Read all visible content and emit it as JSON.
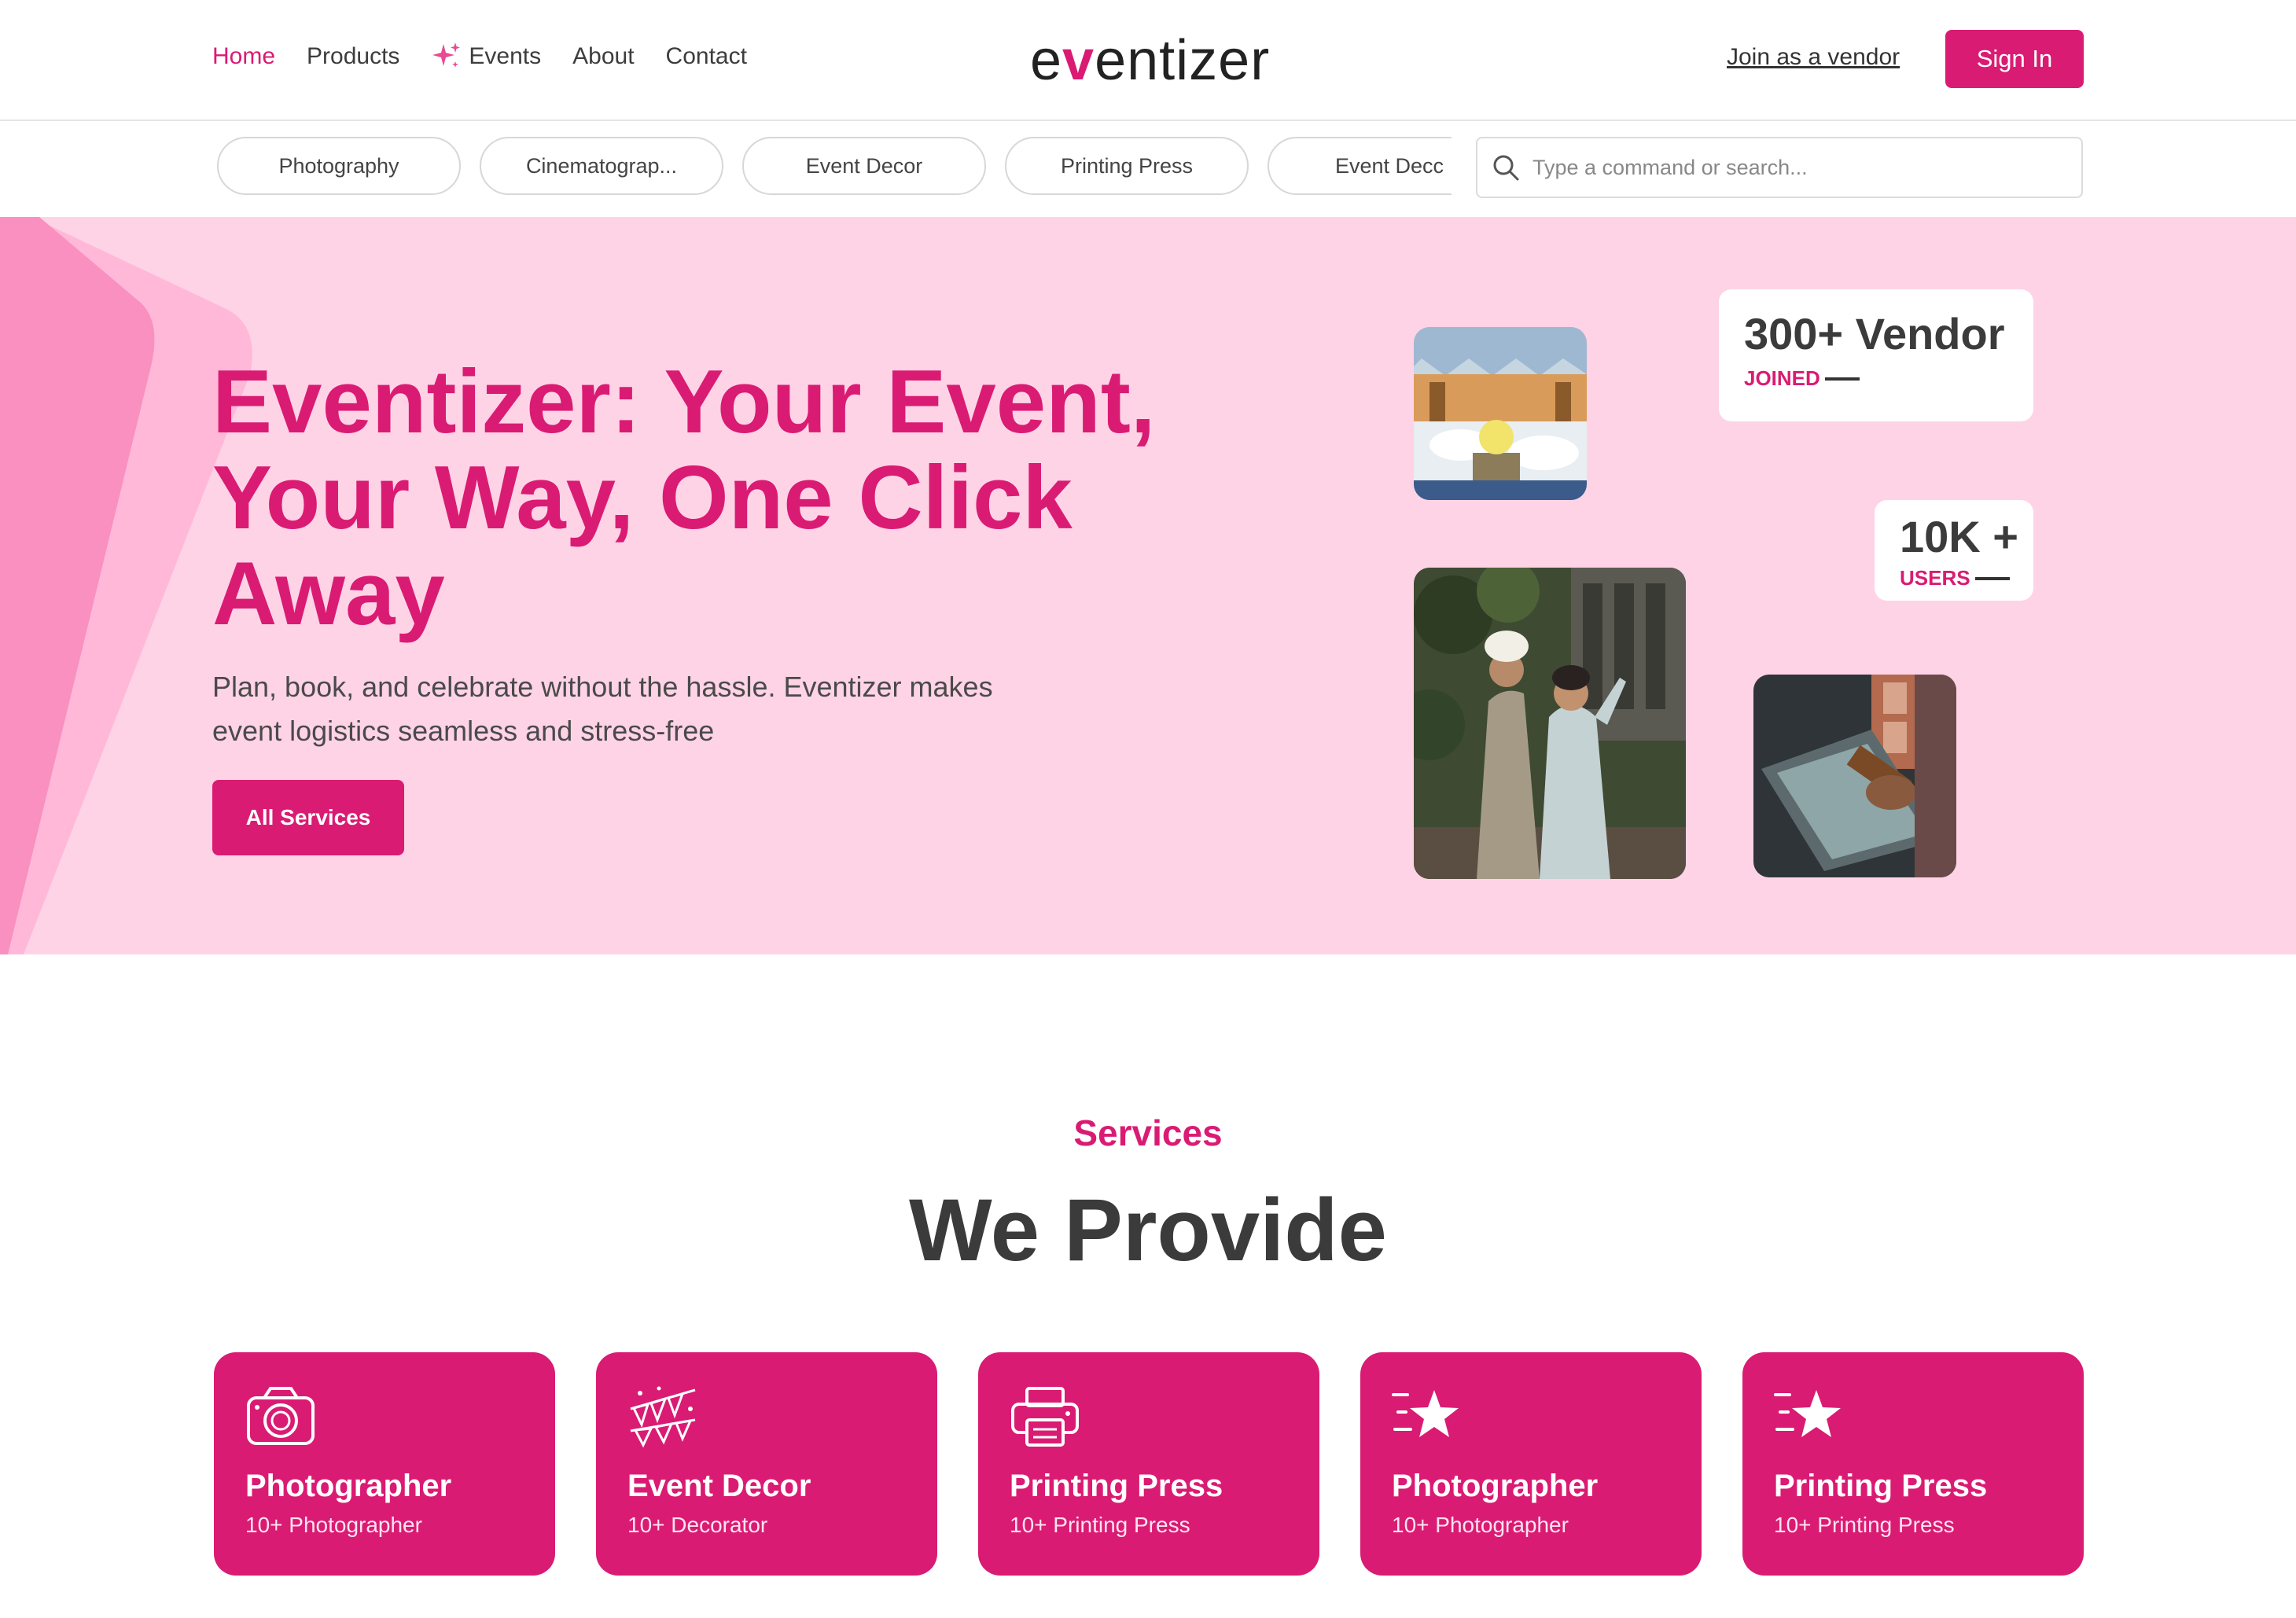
{
  "colors": {
    "brand": "#da1b73",
    "hero_bg": "#ffd3e6",
    "text_dark": "#3b3b3b"
  },
  "nav": {
    "items": [
      {
        "label": "Home",
        "active": true
      },
      {
        "label": "Products"
      },
      {
        "label": "Events",
        "icon": "sparkle-icon"
      },
      {
        "label": "About"
      },
      {
        "label": "Contact"
      }
    ]
  },
  "logo": {
    "prefix": "e",
    "accent": "v",
    "suffix": "entizer"
  },
  "header": {
    "vendor_link": "Join as a vendor",
    "signin": "Sign In"
  },
  "categories": [
    "Photography",
    "Cinematograp...",
    "Event Decor",
    "Printing Press",
    "Event Decc"
  ],
  "search": {
    "placeholder": "Type a command or search..."
  },
  "hero": {
    "title": "Eventizer: Your Event, Your Way, One Click Away",
    "subtitle": "Plan, book, and celebrate without the hassle. Eventizer makes event logistics seamless and stress-free",
    "button": "All Services",
    "stats": [
      {
        "value": "300+ Vendor",
        "label": "JOINED"
      },
      {
        "value": "10K +",
        "label": "USERS"
      }
    ]
  },
  "services": {
    "eyebrow": "Services",
    "title": "We Provide",
    "cards": [
      {
        "name": "Photographer",
        "count": "10+ Photographer",
        "icon": "camera-icon"
      },
      {
        "name": "Event Decor",
        "count": "10+ Decorator",
        "icon": "bunting-icon"
      },
      {
        "name": "Printing Press",
        "count": "10+ Printing Press",
        "icon": "printer-icon"
      },
      {
        "name": "Photographer",
        "count": "10+ Photographer",
        "icon": "star-icon"
      },
      {
        "name": "Printing Press",
        "count": "10+ Printing Press",
        "icon": "star-icon"
      }
    ]
  }
}
